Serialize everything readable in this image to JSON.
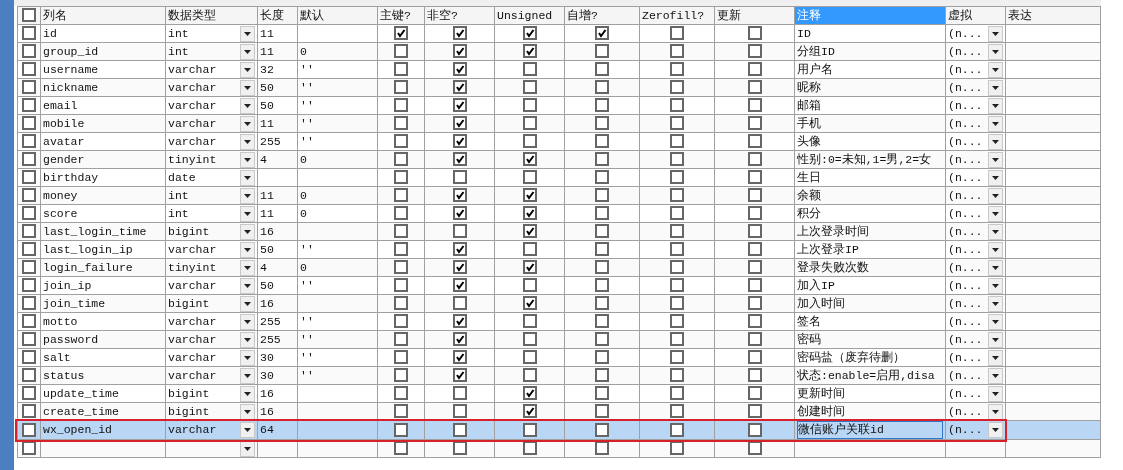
{
  "columns": [
    {
      "label": "列名",
      "selected": false
    },
    {
      "label": "数据类型",
      "selected": false
    },
    {
      "label": "长度",
      "selected": false
    },
    {
      "label": "默认",
      "selected": false
    },
    {
      "label": "主键?",
      "selected": false
    },
    {
      "label": "非空?",
      "selected": false
    },
    {
      "label": "Unsigned",
      "selected": false
    },
    {
      "label": "自增?",
      "selected": false
    },
    {
      "label": "Zerofill?",
      "selected": false
    },
    {
      "label": "更新",
      "selected": false
    },
    {
      "label": "注释",
      "selected": true
    },
    {
      "label": "虚拟",
      "selected": false
    },
    {
      "label": "表达",
      "selected": false
    }
  ],
  "select_all": {
    "checked": false
  },
  "rows": [
    {
      "name": "id",
      "type": "int",
      "length": "11",
      "comment": "ID",
      "virtual": "(n...",
      "flags": [
        true,
        true,
        true,
        true,
        false,
        false
      ],
      "checked": false,
      "selected": false,
      "highlighted": false
    },
    {
      "name": "group_id",
      "type": "int",
      "length": "11",
      "default": "0",
      "comment": "分组ID",
      "virtual": "(n...",
      "flags": [
        false,
        true,
        true,
        false,
        false,
        false
      ],
      "checked": false,
      "selected": false,
      "highlighted": false
    },
    {
      "name": "username",
      "type": "varchar",
      "length": "32",
      "default": "''",
      "comment": "用户名",
      "virtual": "(n...",
      "flags": [
        false,
        true,
        false,
        false,
        false,
        false
      ],
      "checked": false,
      "selected": false,
      "highlighted": false
    },
    {
      "name": "nickname",
      "type": "varchar",
      "length": "50",
      "default": "''",
      "comment": "昵称",
      "virtual": "(n...",
      "flags": [
        false,
        true,
        false,
        false,
        false,
        false
      ],
      "checked": false,
      "selected": false,
      "highlighted": false
    },
    {
      "name": "email",
      "type": "varchar",
      "length": "50",
      "default": "''",
      "comment": "邮箱",
      "virtual": "(n...",
      "flags": [
        false,
        true,
        false,
        false,
        false,
        false
      ],
      "checked": false,
      "selected": false,
      "highlighted": false
    },
    {
      "name": "mobile",
      "type": "varchar",
      "length": "11",
      "default": "''",
      "comment": "手机",
      "virtual": "(n...",
      "flags": [
        false,
        true,
        false,
        false,
        false,
        false
      ],
      "checked": false,
      "selected": false,
      "highlighted": false
    },
    {
      "name": "avatar",
      "type": "varchar",
      "length": "255",
      "default": "''",
      "comment": "头像",
      "virtual": "(n...",
      "flags": [
        false,
        true,
        false,
        false,
        false,
        false
      ],
      "checked": false,
      "selected": false,
      "highlighted": false
    },
    {
      "name": "gender",
      "type": "tinyint",
      "length": "4",
      "default": "0",
      "comment": "性别:0=未知,1=男,2=女",
      "virtual": "(n...",
      "flags": [
        false,
        true,
        true,
        false,
        false,
        false
      ],
      "checked": false,
      "selected": false,
      "highlighted": false
    },
    {
      "name": "birthday",
      "type": "date",
      "comment": "生日",
      "virtual": "(n...",
      "flags": [
        false,
        false,
        false,
        false,
        false,
        false
      ],
      "checked": false,
      "selected": false,
      "highlighted": false
    },
    {
      "name": "money",
      "type": "int",
      "length": "11",
      "default": "0",
      "comment": "余额",
      "virtual": "(n...",
      "flags": [
        false,
        true,
        true,
        false,
        false,
        false
      ],
      "checked": false,
      "selected": false,
      "highlighted": false
    },
    {
      "name": "score",
      "type": "int",
      "length": "11",
      "default": "0",
      "comment": "积分",
      "virtual": "(n...",
      "flags": [
        false,
        true,
        true,
        false,
        false,
        false
      ],
      "checked": false,
      "selected": false,
      "highlighted": false
    },
    {
      "name": "last_login_time",
      "type": "bigint",
      "length": "16",
      "comment": "上次登录时间",
      "virtual": "(n...",
      "flags": [
        false,
        false,
        true,
        false,
        false,
        false
      ],
      "checked": false,
      "selected": false,
      "highlighted": false
    },
    {
      "name": "last_login_ip",
      "type": "varchar",
      "length": "50",
      "default": "''",
      "comment": "上次登录IP",
      "virtual": "(n...",
      "flags": [
        false,
        true,
        false,
        false,
        false,
        false
      ],
      "checked": false,
      "selected": false,
      "highlighted": false
    },
    {
      "name": "login_failure",
      "type": "tinyint",
      "length": "4",
      "default": "0",
      "comment": "登录失败次数",
      "virtual": "(n...",
      "flags": [
        false,
        true,
        true,
        false,
        false,
        false
      ],
      "checked": false,
      "selected": false,
      "highlighted": false
    },
    {
      "name": "join_ip",
      "type": "varchar",
      "length": "50",
      "default": "''",
      "comment": "加入IP",
      "virtual": "(n...",
      "flags": [
        false,
        true,
        false,
        false,
        false,
        false
      ],
      "checked": false,
      "selected": false,
      "highlighted": false
    },
    {
      "name": "join_time",
      "type": "bigint",
      "length": "16",
      "comment": "加入时间",
      "virtual": "(n...",
      "flags": [
        false,
        false,
        true,
        false,
        false,
        false
      ],
      "checked": false,
      "selected": false,
      "highlighted": false
    },
    {
      "name": "motto",
      "type": "varchar",
      "length": "255",
      "default": "''",
      "comment": "签名",
      "virtual": "(n...",
      "flags": [
        false,
        true,
        false,
        false,
        false,
        false
      ],
      "checked": false,
      "selected": false,
      "highlighted": false
    },
    {
      "name": "password",
      "type": "varchar",
      "length": "255",
      "default": "''",
      "comment": "密码",
      "virtual": "(n...",
      "flags": [
        false,
        true,
        false,
        false,
        false,
        false
      ],
      "checked": false,
      "selected": false,
      "highlighted": false
    },
    {
      "name": "salt",
      "type": "varchar",
      "length": "30",
      "default": "''",
      "comment": "密码盐（废弃待删）",
      "virtual": "(n...",
      "flags": [
        false,
        true,
        false,
        false,
        false,
        false
      ],
      "checked": false,
      "selected": false,
      "highlighted": false
    },
    {
      "name": "status",
      "type": "varchar",
      "length": "30",
      "default": "''",
      "comment": "状态:enable=启用,disa",
      "virtual": "(n...",
      "flags": [
        false,
        true,
        false,
        false,
        false,
        false
      ],
      "checked": false,
      "selected": false,
      "highlighted": false
    },
    {
      "name": "update_time",
      "type": "bigint",
      "length": "16",
      "comment": "更新时间",
      "virtual": "(n...",
      "flags": [
        false,
        false,
        true,
        false,
        false,
        false
      ],
      "checked": false,
      "selected": false,
      "highlighted": false
    },
    {
      "name": "create_time",
      "type": "bigint",
      "length": "16",
      "comment": "创建时间",
      "virtual": "(n...",
      "flags": [
        false,
        false,
        true,
        false,
        false,
        false
      ],
      "checked": false,
      "selected": false,
      "highlighted": false
    },
    {
      "name": "wx_open_id",
      "type": "varchar",
      "length": "64",
      "comment": "微信账户关联id",
      "virtual": "(n...",
      "flags": [
        false,
        false,
        false,
        false,
        false,
        false
      ],
      "checked": false,
      "selected": true,
      "highlighted": true
    },
    {
      "flags": [
        false,
        false,
        false,
        false,
        false,
        false
      ],
      "checked": false,
      "selected": false,
      "highlighted": false
    }
  ]
}
